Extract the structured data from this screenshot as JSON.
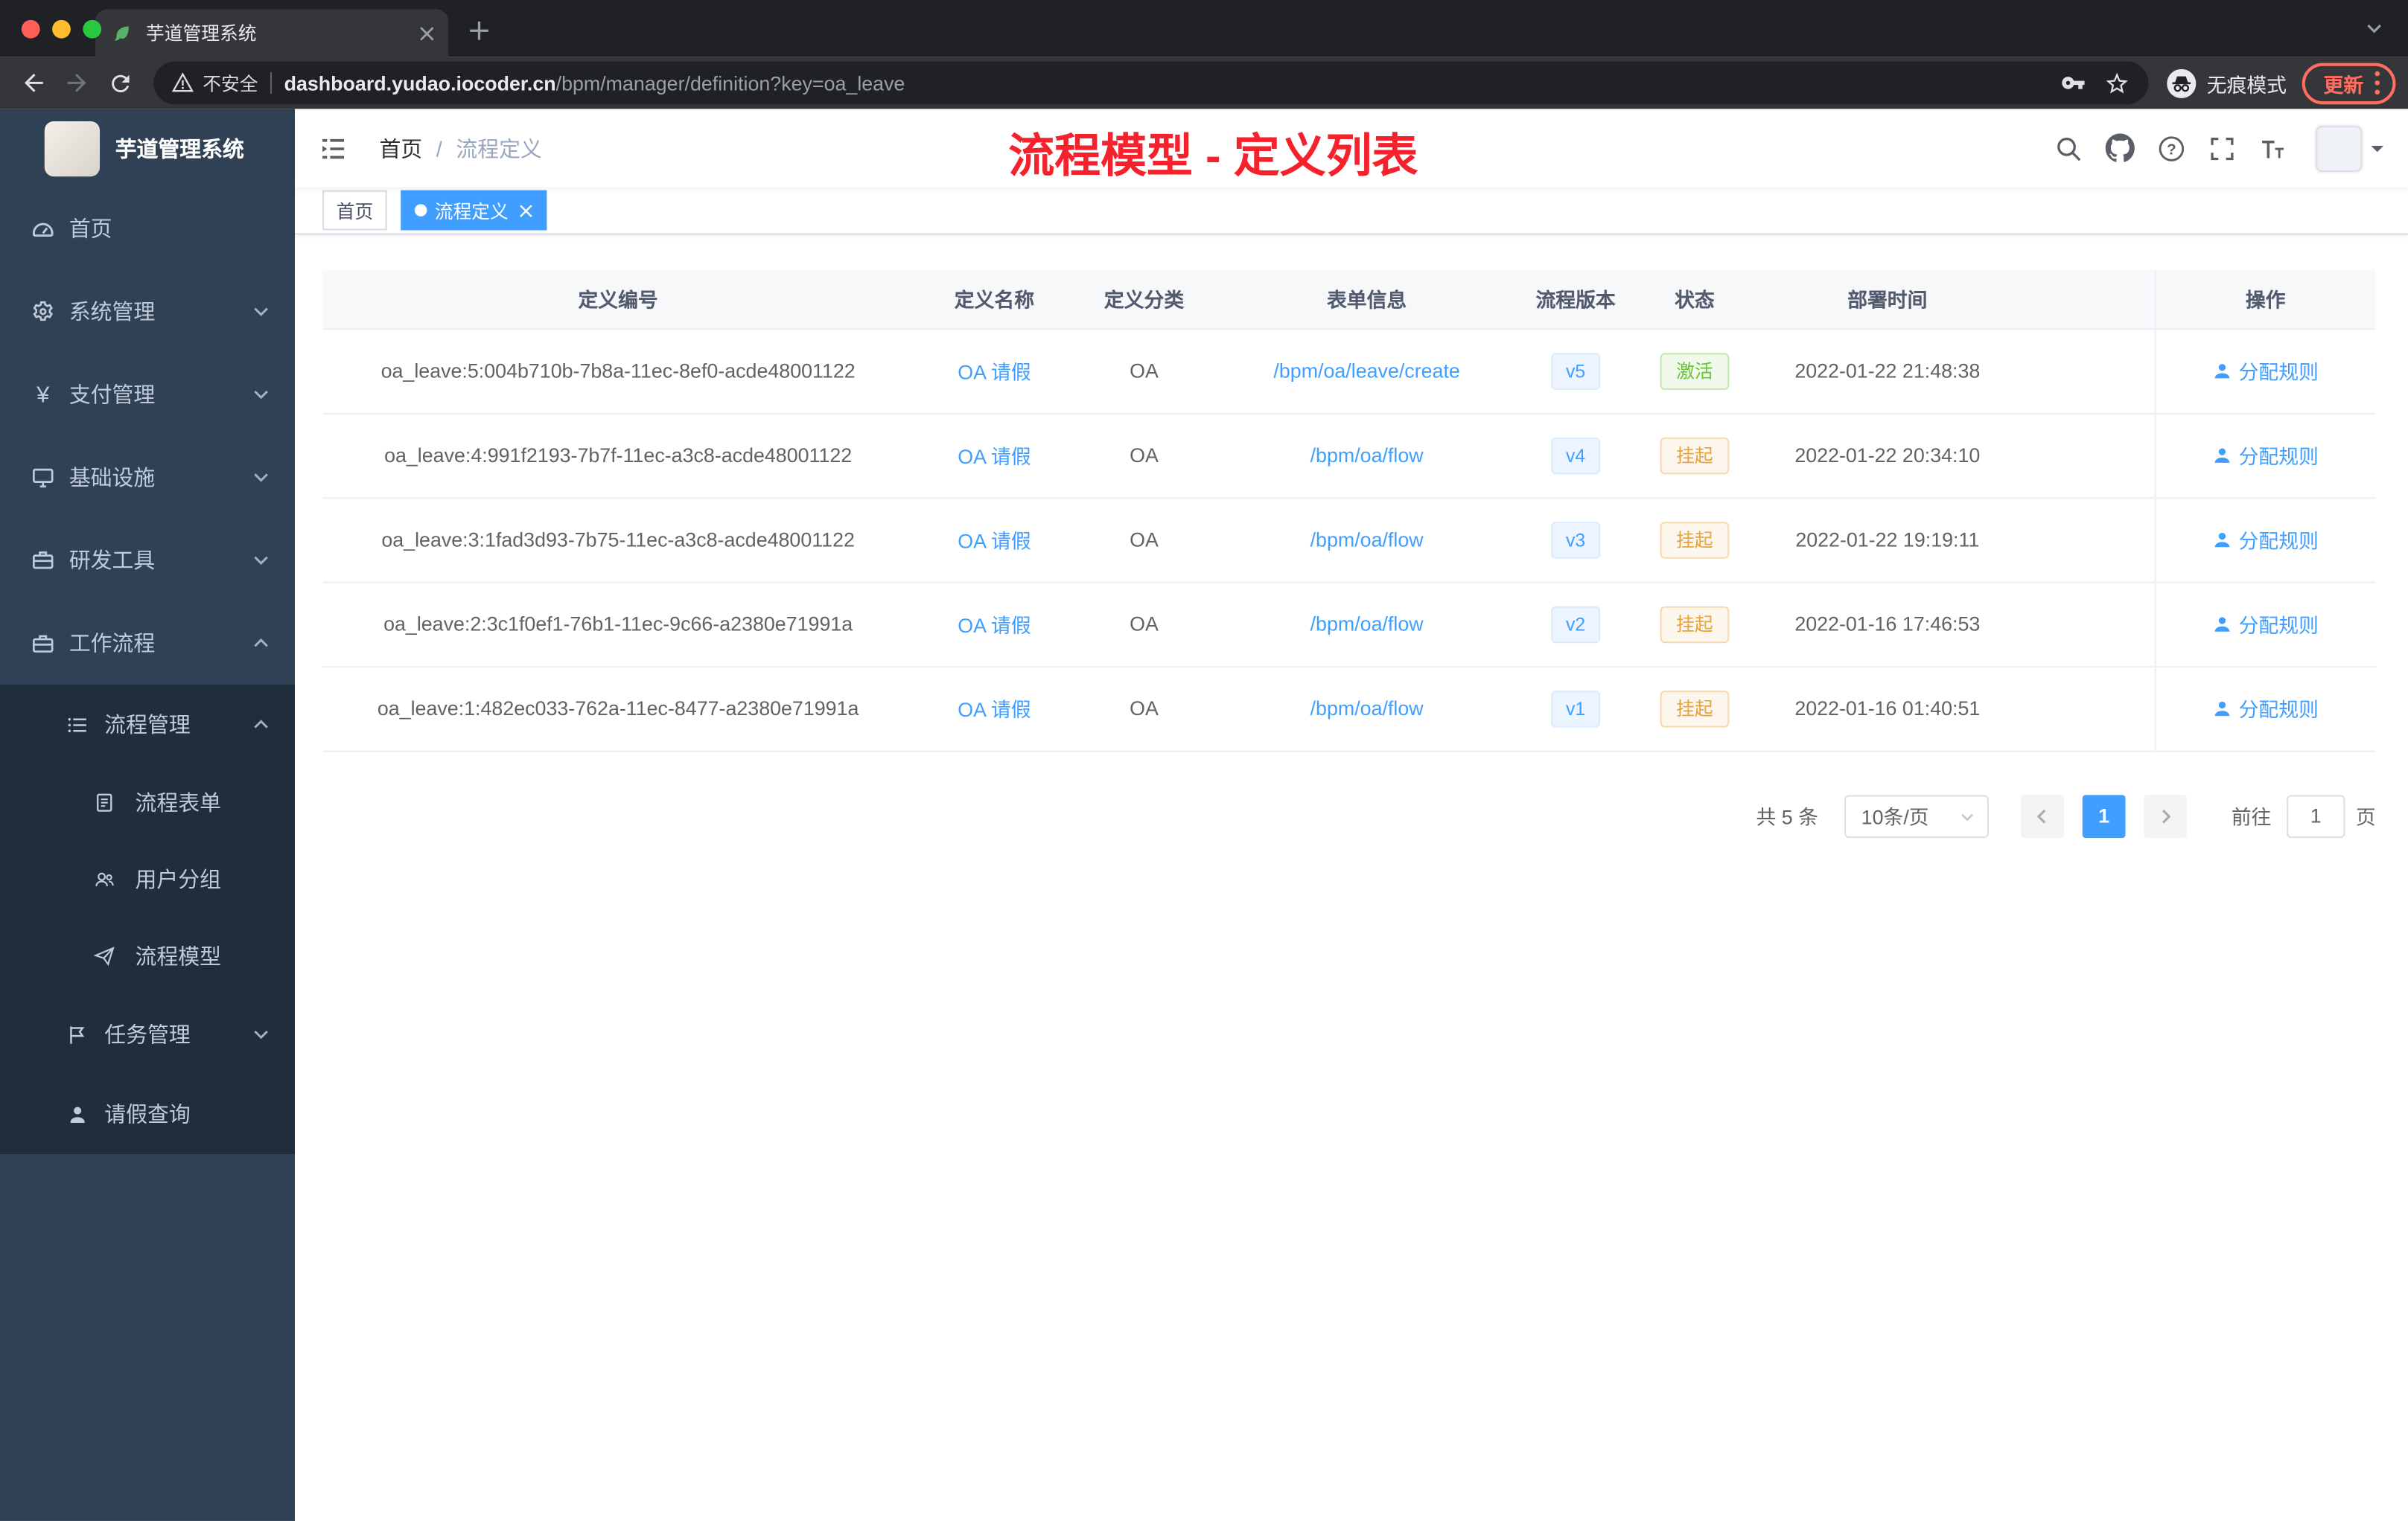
{
  "browser": {
    "tab_title": "芋道管理系统",
    "security_label": "不安全",
    "url_host": "dashboard.yudao.iocoder.cn",
    "url_path": "/bpm/manager/definition?key=oa_leave",
    "incognito_label": "无痕模式",
    "update_label": "更新"
  },
  "icons": {
    "yen": "¥",
    "question": "?"
  },
  "sidebar": {
    "logo_title": "芋道管理系统",
    "items": [
      {
        "label": "首页"
      },
      {
        "label": "系统管理"
      },
      {
        "label": "支付管理"
      },
      {
        "label": "基础设施"
      },
      {
        "label": "研发工具"
      },
      {
        "label": "工作流程"
      }
    ],
    "sub_items": [
      {
        "label": "流程管理"
      },
      {
        "label": "流程表单"
      },
      {
        "label": "用户分组"
      },
      {
        "label": "流程模型"
      },
      {
        "label": "任务管理"
      },
      {
        "label": "请假查询"
      }
    ]
  },
  "header": {
    "breadcrumb_home": "首页",
    "breadcrumb_separator": "/",
    "breadcrumb_current": "流程定义",
    "annotation": "流程模型 - 定义列表"
  },
  "tags": {
    "home": "首页",
    "active": "流程定义"
  },
  "table": {
    "columns": [
      "定义编号",
      "定义名称",
      "定义分类",
      "表单信息",
      "流程版本",
      "状态",
      "部署时间",
      "操作"
    ],
    "rows": [
      {
        "id": "oa_leave:5:004b710b-7b8a-11ec-8ef0-acde48001122",
        "name": "OA 请假",
        "category": "OA",
        "form": "/bpm/oa/leave/create",
        "version": "v5",
        "status": "激活",
        "status_type": "success",
        "time": "2022-01-22 21:48:38",
        "action": "分配规则"
      },
      {
        "id": "oa_leave:4:991f2193-7b7f-11ec-a3c8-acde48001122",
        "name": "OA 请假",
        "category": "OA",
        "form": "/bpm/oa/flow",
        "version": "v4",
        "status": "挂起",
        "status_type": "warning",
        "time": "2022-01-22 20:34:10",
        "action": "分配规则"
      },
      {
        "id": "oa_leave:3:1fad3d93-7b75-11ec-a3c8-acde48001122",
        "name": "OA 请假",
        "category": "OA",
        "form": "/bpm/oa/flow",
        "version": "v3",
        "status": "挂起",
        "status_type": "warning",
        "time": "2022-01-22 19:19:11",
        "action": "分配规则"
      },
      {
        "id": "oa_leave:2:3c1f0ef1-76b1-11ec-9c66-a2380e71991a",
        "name": "OA 请假",
        "category": "OA",
        "form": "/bpm/oa/flow",
        "version": "v2",
        "status": "挂起",
        "status_type": "warning",
        "time": "2022-01-16 17:46:53",
        "action": "分配规则"
      },
      {
        "id": "oa_leave:1:482ec033-762a-11ec-8477-a2380e71991a",
        "name": "OA 请假",
        "category": "OA",
        "form": "/bpm/oa/flow",
        "version": "v1",
        "status": "挂起",
        "status_type": "warning",
        "time": "2022-01-16 01:40:51",
        "action": "分配规则"
      }
    ]
  },
  "pagination": {
    "total": "共 5 条",
    "page_size": "10条/页",
    "current_page": "1",
    "goto_label": "前往",
    "goto_value": "1",
    "page_unit": "页"
  },
  "colors": {
    "accent": "#409eff",
    "success": "#67c23a",
    "warning": "#e6a23c",
    "annotation_red": "#f5222d",
    "sidebar_bg": "#304156",
    "submenu_bg": "#1f2d3d",
    "update_red": "#ff6e5e",
    "active_tag_bg": "#409eff"
  }
}
